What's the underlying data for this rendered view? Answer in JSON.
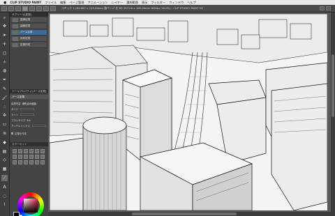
{
  "menubar": {
    "apple": "",
    "app_name": "CLIP STUDIO PAINT",
    "items": [
      "ファイル",
      "編集",
      "ページ管理",
      "アニメーション",
      "レイヤー",
      "選択範囲",
      "表示",
      "フィルター",
      "ウィンドウ",
      "ヘルプ"
    ]
  },
  "toolbar": {
    "title": "コミック 2 (84.667 x 213.06mm 脇ページ 右 B5 157.00 x 185.00mm 600dpi 16.0%) - CLIP STUDIO PAINT EX"
  },
  "tools": [
    {
      "name": "zoom-tool-icon",
      "glyph": "⌕"
    },
    {
      "name": "move-tool-icon",
      "glyph": "✥"
    },
    {
      "name": "operation-tool-icon",
      "glyph": "➤"
    },
    {
      "name": "move-layer-tool-icon",
      "glyph": "✛"
    },
    {
      "name": "selection-tool-icon",
      "glyph": "▢"
    },
    {
      "name": "auto-select-tool-icon",
      "glyph": "✧"
    },
    {
      "name": "eyedropper-tool-icon",
      "glyph": "◍"
    },
    {
      "name": "pen-tool-icon",
      "glyph": "✒"
    },
    {
      "name": "pencil-tool-icon",
      "glyph": "✎"
    },
    {
      "name": "brush-tool-icon",
      "glyph": "🖌"
    },
    {
      "name": "airbrush-tool-icon",
      "glyph": "∴"
    },
    {
      "name": "decoration-tool-icon",
      "glyph": "✲"
    },
    {
      "name": "eraser-tool-icon",
      "glyph": "▭"
    },
    {
      "name": "blend-tool-icon",
      "glyph": "≋"
    },
    {
      "name": "fill-tool-icon",
      "glyph": "◆"
    },
    {
      "name": "gradient-tool-icon",
      "glyph": "▤"
    },
    {
      "name": "figure-tool-icon",
      "glyph": "◇"
    },
    {
      "name": "frame-tool-icon",
      "glyph": "▦"
    },
    {
      "name": "ruler-tool-icon",
      "glyph": "⟋"
    },
    {
      "name": "text-tool-icon",
      "glyph": "A"
    },
    {
      "name": "balloon-tool-icon",
      "glyph": "◌"
    },
    {
      "name": "correct-line-tool-icon",
      "glyph": "⌇"
    }
  ],
  "sub_tool_panel": {
    "title": "サブツール[定規]",
    "items": [
      {
        "label": "直線定規",
        "selected": false
      },
      {
        "label": "曲線定規",
        "selected": false
      },
      {
        "label": "パース定規",
        "selected": true
      },
      {
        "label": "対称定規",
        "selected": false
      },
      {
        "label": "定規作成",
        "selected": false
      }
    ]
  },
  "tool_property": {
    "title": "ツールプロパティ[パース定規]",
    "tab": "パース定規",
    "props": [
      {
        "label": "処理内容",
        "value": "消失点の追加"
      },
      {
        "label": "ガイド",
        "value": ""
      },
      {
        "label": "ライン",
        "value": ""
      },
      {
        "label": "ブラシサイズ",
        "value": "3.0"
      },
      {
        "label": "アンチエイリアス",
        "value": ""
      },
      {
        "label": "定規を作成",
        "value": ""
      }
    ],
    "checkbox_label": "定規を作成"
  },
  "palette_title": "カラーセット",
  "colors": {
    "accent": "#3d6a9c",
    "panel": "#444444",
    "canvas": "#f4f4f4"
  }
}
